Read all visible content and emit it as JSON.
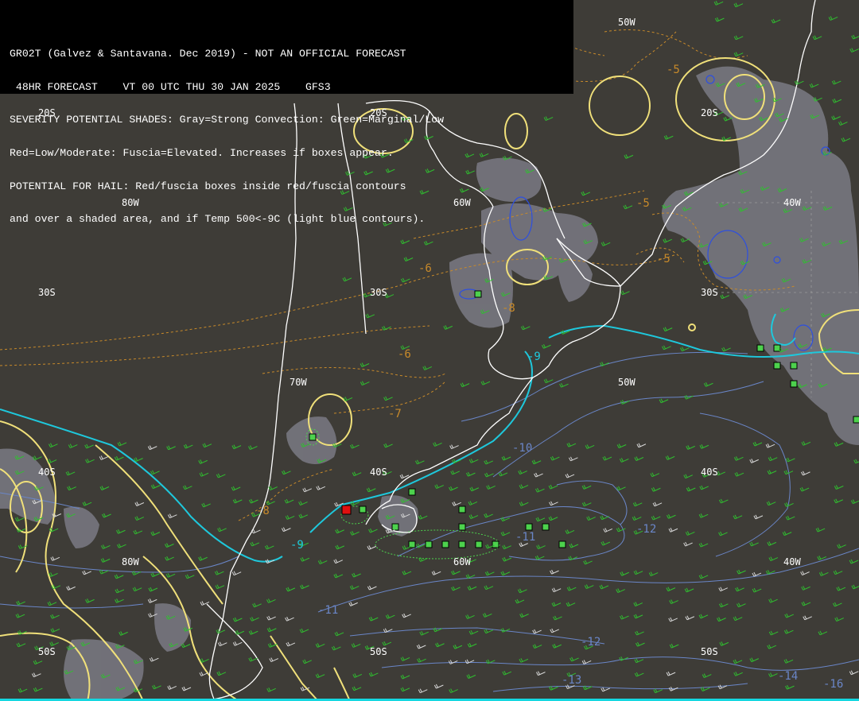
{
  "header": {
    "lines": [
      "GR02T (Galvez & Santavana. Dec 2019) - NOT AN OFFICIAL FORECAST",
      " 48HR FORECAST    VT 00 UTC THU 30 JAN 2025    GFS3",
      "SEVERITY POTENTIAL SHADES: Gray=Strong Convection: Green=Marginal/Low",
      "Red=Low/Moderate: Fuscia=Elevated. Increases if boxes appear.",
      "POTENTIAL FOR HAIL: Red/fuscia boxes inside red/fuscia contours",
      "and over a shaded area, and if Temp 500<-9C (light blue contours)."
    ]
  },
  "grid_labels": {
    "lon": [
      "80W",
      "70W",
      "60W",
      "50W",
      "40W"
    ],
    "lat": [
      "20S",
      "30S",
      "40S",
      "50S"
    ]
  },
  "contour_labels": {
    "orange": [
      "-5",
      "-5",
      "-6",
      "-5",
      "-6",
      "-6",
      "-7",
      "-7",
      "-8",
      "-8"
    ],
    "cyan": [
      "-9",
      "-9",
      "-9"
    ],
    "blue": [
      "-10",
      "-11",
      "-11",
      "-12",
      "-12",
      "-13",
      "-14",
      "-16"
    ]
  },
  "colors": {
    "background": "#3e3c37",
    "coastline": "#ffffff",
    "severity_gray": "#7a7a84",
    "marginal_green": "#4dd24d",
    "hail_red": "#e01010",
    "temp_500_cyan": "#1ec8dc",
    "temp_orange": "#c88a2a",
    "temp_blue": "#6a86c8",
    "high_contour_yellow": "#f0e07a",
    "wind_barbs_green": "#2fbf2f",
    "wind_barbs_white": "#d8d8d8"
  }
}
